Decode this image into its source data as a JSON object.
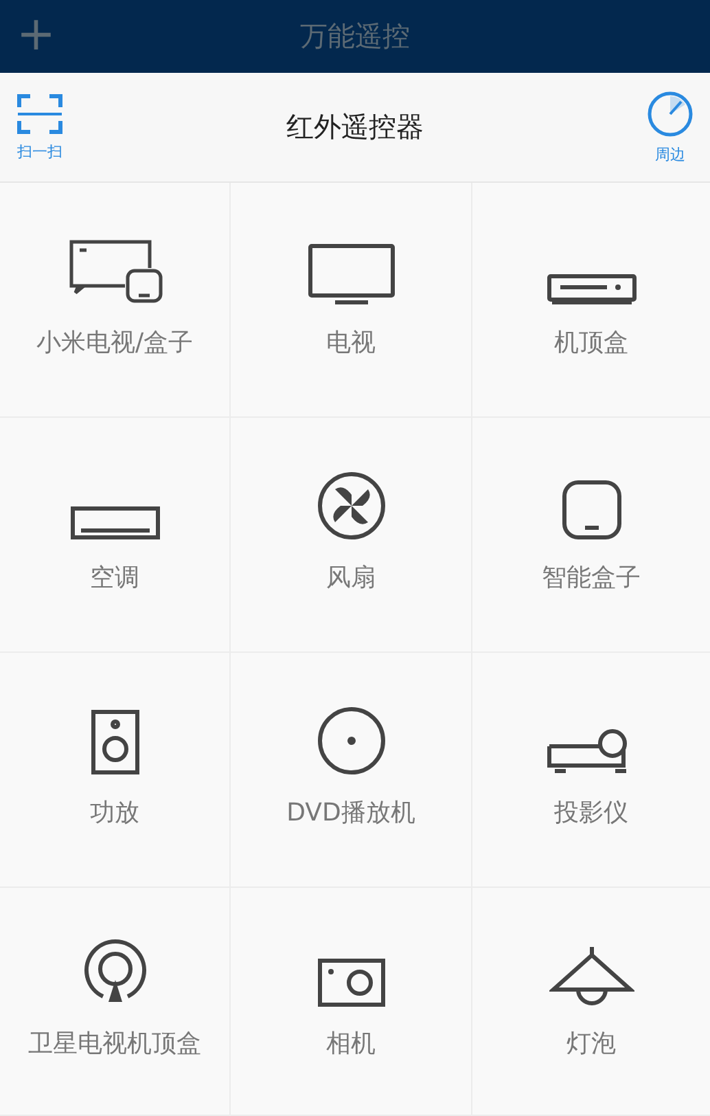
{
  "top_bar": {
    "add_icon_char": "+",
    "title": "万能遥控"
  },
  "header": {
    "scan_label": "扫一扫",
    "title": "红外遥控器",
    "nearby_label": "周边"
  },
  "devices": [
    {
      "kind": "mitv",
      "label": "小米电视/盒子"
    },
    {
      "kind": "tv",
      "label": "电视"
    },
    {
      "kind": "stb",
      "label": "机顶盒"
    },
    {
      "kind": "ac",
      "label": "空调"
    },
    {
      "kind": "fan",
      "label": "风扇"
    },
    {
      "kind": "box",
      "label": "智能盒子"
    },
    {
      "kind": "speaker",
      "label": "功放"
    },
    {
      "kind": "dvd",
      "label": "DVD播放机"
    },
    {
      "kind": "projector",
      "label": "投影仪"
    },
    {
      "kind": "satellite",
      "label": "卫星电视机顶盒"
    },
    {
      "kind": "camera",
      "label": "相机"
    },
    {
      "kind": "lamp",
      "label": "灯泡"
    }
  ]
}
